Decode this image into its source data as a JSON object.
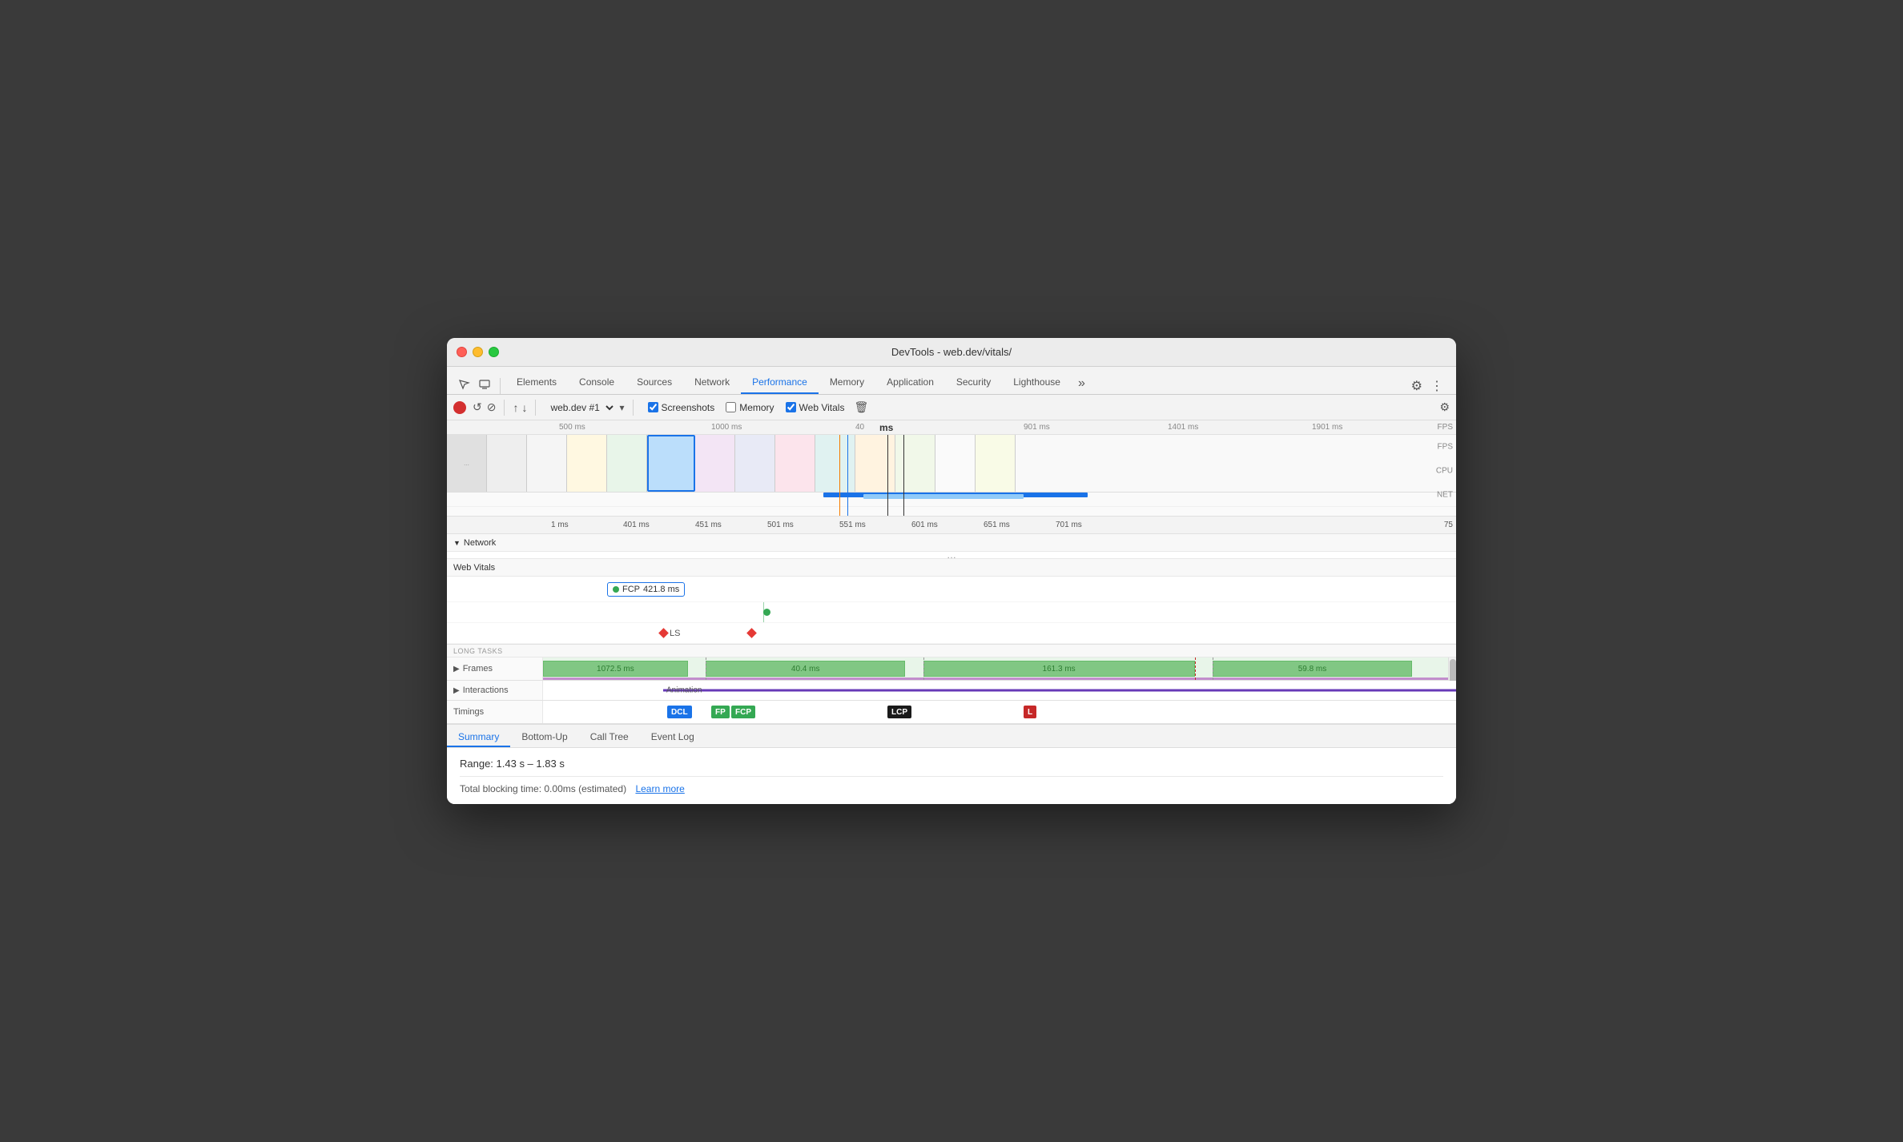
{
  "window": {
    "title": "DevTools - web.dev/vitals/"
  },
  "traffic_lights": {
    "red_label": "close",
    "yellow_label": "minimize",
    "green_label": "maximize"
  },
  "toolbar": {
    "inspector_icon": "⬡",
    "device_icon": "▭",
    "record_btn": "●",
    "reload_btn": "↺",
    "clear_btn": "⊘",
    "upload_icon": "↑",
    "download_icon": "↓",
    "session_label": "web.dev #1",
    "screenshots_label": "Screenshots",
    "memory_label": "Memory",
    "web_vitals_label": "Web Vitals",
    "settings_icon": "⚙",
    "more_icon": "⋮"
  },
  "nav_tabs": {
    "items": [
      {
        "id": "elements",
        "label": "Elements",
        "active": false
      },
      {
        "id": "console",
        "label": "Console",
        "active": false
      },
      {
        "id": "sources",
        "label": "Sources",
        "active": false
      },
      {
        "id": "network",
        "label": "Network",
        "active": false
      },
      {
        "id": "performance",
        "label": "Performance",
        "active": true
      },
      {
        "id": "memory",
        "label": "Memory",
        "active": false
      },
      {
        "id": "application",
        "label": "Application",
        "active": false
      },
      {
        "id": "security",
        "label": "Security",
        "active": false
      },
      {
        "id": "lighthouse",
        "label": "Lighthouse",
        "active": false
      }
    ],
    "more_label": "»"
  },
  "overview": {
    "ruler_marks": [
      "500 ms",
      "1000 ms",
      "40",
      "ms",
      "901 ms",
      "1401 ms",
      "1901 ms"
    ],
    "fps_label": "FPS",
    "cpu_label": "CPU",
    "net_label": "NET"
  },
  "timeline": {
    "ruler_marks": [
      "1 ms",
      "401 ms",
      "451 ms",
      "501 ms",
      "551 ms",
      "601 ms",
      "651 ms",
      "701 ms",
      "75"
    ],
    "network_label": "Network",
    "web_vitals_label": "Web Vitals",
    "long_tasks_label": "LONG TASKS",
    "dots_label": "…"
  },
  "web_vitals": {
    "fcp_label": "FCP",
    "fcp_value": "421.8 ms",
    "ls_label": "LS"
  },
  "frames": {
    "label": "Frames",
    "bars": [
      {
        "label": "1072.5 ms",
        "left_pct": 0,
        "width_pct": 18
      },
      {
        "label": "40.4 ms",
        "left_pct": 20,
        "width_pct": 25
      },
      {
        "label": "161.3 ms",
        "left_pct": 47,
        "width_pct": 28
      },
      {
        "label": "59.8 ms",
        "left_pct": 77,
        "width_pct": 18
      }
    ]
  },
  "interactions": {
    "label": "Interactions",
    "animation_label": "Animation"
  },
  "timings": {
    "label": "Timings",
    "dcl_label": "DCL",
    "fp_label": "FP",
    "fcp_label": "FCP",
    "lcp_label": "LCP",
    "l_label": "L"
  },
  "bottom_tabs": {
    "items": [
      {
        "id": "summary",
        "label": "Summary",
        "active": true
      },
      {
        "id": "bottom-up",
        "label": "Bottom-Up",
        "active": false
      },
      {
        "id": "call-tree",
        "label": "Call Tree",
        "active": false
      },
      {
        "id": "event-log",
        "label": "Event Log",
        "active": false
      }
    ]
  },
  "summary": {
    "range_label": "Range: 1.43 s – 1.83 s",
    "blocking_time_label": "Total blocking time: 0.00ms (estimated)",
    "learn_more_label": "Learn more"
  }
}
